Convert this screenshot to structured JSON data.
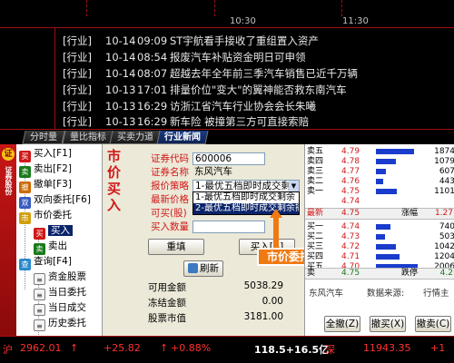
{
  "chart_strip": {
    "ticks": [
      "10:30",
      "11:30"
    ]
  },
  "news": [
    {
      "category": "[行业]",
      "date": "10-14",
      "time": "09:09",
      "title": "ST宇航看手接收了重组置入资产"
    },
    {
      "category": "[行业]",
      "date": "10-14",
      "time": "08:54",
      "title": "报废汽车补贴资金明日可申领"
    },
    {
      "category": "[行业]",
      "date": "10-14",
      "time": "08:07",
      "title": "超越去年全年前三季汽车销售已近千万辆"
    },
    {
      "category": "[行业]",
      "date": "10-13",
      "time": "17:01",
      "title": "排量价位\"变大\"的翼神能否救东南汽车"
    },
    {
      "category": "[行业]",
      "date": "10-13",
      "time": "16:29",
      "title": "访浙江省汽车行业协会会长朱曦"
    },
    {
      "category": "[行业]",
      "date": "10-13",
      "time": "16:29",
      "title": "新车险 被撞第三方可直接索赔"
    }
  ],
  "tabs": [
    "分时量",
    "量比指标",
    "买卖力道",
    "行业新闻"
  ],
  "active_tab": "行业新闻",
  "brand": {
    "logo": "证",
    "text": "证券股份"
  },
  "tree": {
    "buy": "买入[F1]",
    "sell": "卖出[F2]",
    "cancel": "撤单[F3]",
    "dual": "双向委托[F6]",
    "market": "市价委托",
    "market_buy": "买入",
    "market_sell": "卖出",
    "query": "查询[F4]",
    "funds": "资金股票",
    "today_orders": "当日委托",
    "today_trades": "当日成交",
    "history_orders": "历史委托"
  },
  "form": {
    "title": "市价买入",
    "labels": {
      "code": "证券代码",
      "name": "证券名称",
      "strategy": "报价策略",
      "price": "最新价格",
      "available": "可买(股)",
      "quantity": "买入数量"
    },
    "values": {
      "code": "600006",
      "name": "东风汽车",
      "strategy": "1-最优五档即时成交剩",
      "quantity": ""
    },
    "dropdown_options": [
      "1-最优五档即时成交剩余",
      "2-最优五档即时成交剩余撤"
    ],
    "buttons": {
      "refill": "重填",
      "buy": "买入[B]",
      "refresh": "刷新"
    },
    "summary": [
      {
        "label": "可用金额",
        "value": "5038.29"
      },
      {
        "label": "冻结金额",
        "value": "0.00"
      },
      {
        "label": "股票市值",
        "value": "3181.00"
      }
    ],
    "callout": "市价委托策略选择"
  },
  "book": {
    "asks": [
      {
        "level": "卖五",
        "price": "4.79",
        "volume": "1874",
        "bar": 0.84
      },
      {
        "level": "卖四",
        "price": "4.78",
        "volume": "1079",
        "bar": 0.44
      },
      {
        "level": "卖三",
        "price": "4.77",
        "volume": "607",
        "bar": 0.22
      },
      {
        "level": "卖二",
        "price": "4.76",
        "volume": "443",
        "bar": 0.16
      },
      {
        "level": "卖一",
        "price": "4.75",
        "volume": "1101",
        "bar": 0.46
      },
      {
        "level": "",
        "price": "4.74",
        "volume": "",
        "bar": 0
      }
    ],
    "mid_top": {
      "label": "最新",
      "price": "4.75",
      "change_label": "涨幅",
      "change": "1.27"
    },
    "bids": [
      {
        "level": "买一",
        "price": "4.74",
        "volume": "740",
        "bar": 0.32
      },
      {
        "level": "买二",
        "price": "4.73",
        "volume": "503",
        "bar": 0.2
      },
      {
        "level": "买三",
        "price": "4.72",
        "volume": "1042",
        "bar": 0.44
      },
      {
        "level": "买四",
        "price": "4.71",
        "volume": "1204",
        "bar": 0.52
      },
      {
        "level": "买五",
        "price": "4.70",
        "volume": "2006",
        "bar": 0.92
      }
    ],
    "mid_bottom": {
      "label": "卖",
      "price": "4.75",
      "change_label": "跌停",
      "change": "4.2"
    },
    "foot": {
      "name": "东风汽车",
      "source_label": "数据来源:",
      "source": "行情主"
    },
    "buttons": [
      "全撤(Z)",
      "撤买(X)",
      "撤卖(C)"
    ]
  },
  "status": {
    "sh_label": "沪",
    "sh_index": "2962.01",
    "sh_arrow": "↑",
    "sh_change": "+25.82",
    "sh_pct": "+0.88%",
    "amount": "118.5+16.5亿",
    "sz_label": "深",
    "sz_index": "11943.35",
    "sz_change": "+1"
  }
}
